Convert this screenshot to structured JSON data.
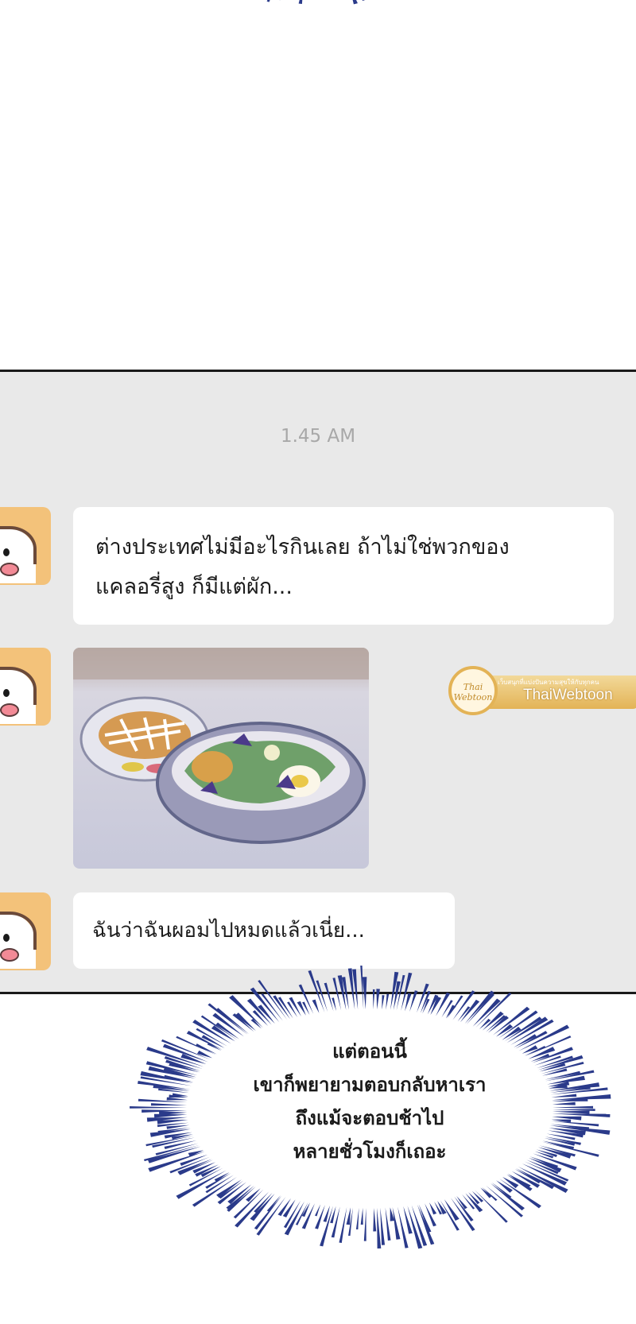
{
  "chat": {
    "timestamp": "1.45 AM",
    "messages": [
      {
        "lines": [
          "ต่างประเทศไม่มีอะไรกินเลย ถ้าไม่ใช่พวกของ",
          "แคลอรี่สูง ก็มีแต่ผัก..."
        ]
      },
      {
        "image": "food-photo"
      },
      {
        "lines": [
          "ฉันว่าฉันผอมไปหมดแล้วเนี่ย..."
        ]
      }
    ]
  },
  "watermark": {
    "logo_text": "Thai Webtoon",
    "tagline": "เว็บสนุกที่แบ่งปันความสุขให้กับทุกคน",
    "name": "ThaiWebtoon"
  },
  "narration": {
    "lines": [
      "แต่ตอนนี้",
      "เขาก็พยายามตอบกลับหาเรา",
      "ถึงแม้จะตอบช้าไป",
      "หลายชั่วโมงก็เถอะ"
    ]
  },
  "colors": {
    "panel_bg": "#e9e9e9",
    "bubble_bg": "#ffffff",
    "burst_lines": "#2a3a8a",
    "avatar_bg": "#f3c27a",
    "watermark_gold": "#e3b356"
  }
}
